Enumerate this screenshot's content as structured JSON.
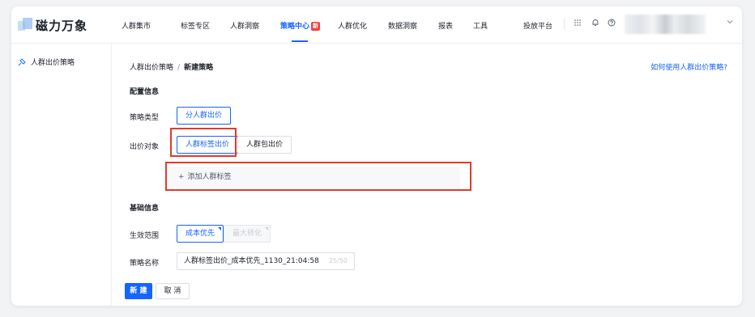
{
  "app": {
    "logo_text": "磁力万象"
  },
  "topnav": {
    "menu": [
      "人群集市",
      "标签专区",
      "人群洞察",
      "策略中心",
      "人群优化",
      "数据洞察",
      "报表",
      "工具"
    ],
    "active_index": 3,
    "new_badge": "新",
    "right_link": "投放平台",
    "icons": [
      "apps-grid-icon",
      "bell-icon",
      "help-circle-icon",
      "chevron-down-icon"
    ]
  },
  "sidebar": {
    "items": [
      {
        "label": "人群出价策略",
        "icon": "strategy-icon"
      }
    ]
  },
  "main": {
    "breadcrumb": {
      "parent": "人群出价策略",
      "separator": "/",
      "current": "新建策略"
    },
    "help_link": "如何使用人群出价策略?",
    "config_section": "配置信息",
    "strategy_type": {
      "label": "策略类型",
      "options": [
        "分人群出价"
      ],
      "selected": "分人群出价"
    },
    "bid_target": {
      "label": "出价对象",
      "options": [
        "人群标签出价",
        "人群包出价"
      ],
      "selected": "人群标签出价"
    },
    "add_tag": {
      "plus": "+",
      "label": "添加人群标签"
    },
    "basic_section": "基础信息",
    "scope": {
      "label": "生效范围",
      "options": [
        "成本优先",
        "最大转化"
      ],
      "selected": "成本优先"
    },
    "name": {
      "label": "策略名称",
      "value": "人群标签出价_成本优先_1130_21:04:58",
      "count": "25/50"
    },
    "actions": {
      "create": "新 建",
      "cancel": "取 消"
    }
  },
  "colors": {
    "accent": "#1664ff",
    "highlight": "#e23b2a"
  }
}
